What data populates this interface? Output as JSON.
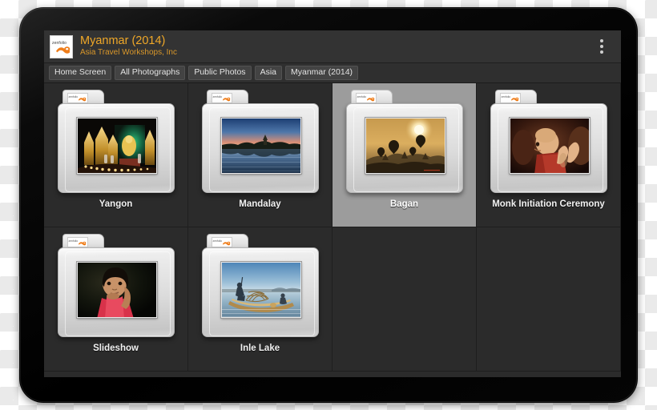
{
  "app": {
    "logo_text": "zenfolio",
    "logo_icon": "zenfolio-swoosh-icon",
    "title": "Myanmar (2014)",
    "subtitle": "Asia Travel Workshops, Inc",
    "overflow_icon": "overflow-menu-icon",
    "title_color": "#f0a828",
    "subtitle_color": "#d9972a",
    "appbar_bg": "#333333",
    "screen_bg": "#2b2b2b",
    "selected_cell_bg": "#9c9c9c"
  },
  "breadcrumbs": [
    {
      "label": "Home Screen"
    },
    {
      "label": "All Photographs"
    },
    {
      "label": "Public Photos"
    },
    {
      "label": "Asia"
    },
    {
      "label": "Myanmar (2014)"
    }
  ],
  "gallery": {
    "folders": [
      {
        "label": "Yangon",
        "selected": false,
        "thumb": "temple-candles"
      },
      {
        "label": "Mandalay",
        "selected": false,
        "thumb": "lake-dusk"
      },
      {
        "label": "Bagan",
        "selected": true,
        "thumb": "balloons-sunrise"
      },
      {
        "label": "Monk Initiation Ceremony",
        "selected": false,
        "thumb": "praying-monk-child"
      },
      {
        "label": "Slideshow",
        "selected": false,
        "thumb": "girl-portrait"
      },
      {
        "label": "Inle Lake",
        "selected": false,
        "thumb": "fisherman-boat"
      }
    ],
    "empty_cells": 2,
    "columns": 4
  }
}
